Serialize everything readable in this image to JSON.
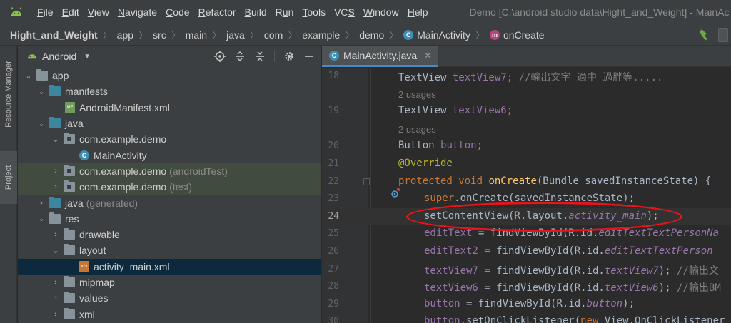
{
  "menu": {
    "items": [
      "File",
      "Edit",
      "View",
      "Navigate",
      "Code",
      "Refactor",
      "Build",
      "Run",
      "Tools",
      "VCS",
      "Window",
      "Help"
    ],
    "underlined": [
      "F",
      "E",
      "V",
      "N",
      "C",
      "R",
      "B",
      "u",
      "T",
      "S",
      "W",
      "H"
    ],
    "window_title": "Demo [C:\\android studio data\\Hight_and_Weight] - MainAc"
  },
  "breadcrumb": {
    "items": [
      "Hight_and_Weight",
      "app",
      "src",
      "main",
      "java",
      "com",
      "example",
      "demo"
    ],
    "class_item": "MainActivity",
    "method_item": "onCreate",
    "class_badge": "C",
    "method_badge": "m"
  },
  "sidebar_tabs": {
    "resource_manager": "Resource Manager",
    "project": "Project"
  },
  "project_panel": {
    "title": "Android",
    "tree": [
      {
        "label": "app",
        "suffix": ""
      },
      {
        "label": "manifests",
        "suffix": ""
      },
      {
        "label": "AndroidManifest.xml",
        "suffix": ""
      },
      {
        "label": "java",
        "suffix": ""
      },
      {
        "label": "com.example.demo",
        "suffix": ""
      },
      {
        "label": "MainActivity",
        "suffix": ""
      },
      {
        "label": "com.example.demo",
        "suffix": "(androidTest)"
      },
      {
        "label": "com.example.demo",
        "suffix": "(test)"
      },
      {
        "label": "java",
        "suffix": "(generated)"
      },
      {
        "label": "res",
        "suffix": ""
      },
      {
        "label": "drawable",
        "suffix": ""
      },
      {
        "label": "layout",
        "suffix": ""
      },
      {
        "label": "activity_main.xml",
        "suffix": ""
      },
      {
        "label": "mipmap",
        "suffix": ""
      },
      {
        "label": "values",
        "suffix": ""
      },
      {
        "label": "xml",
        "suffix": ""
      }
    ]
  },
  "editor": {
    "tab_label": "MainActivity.java",
    "tab_close": "✕",
    "usages_label": "2 usages",
    "line_numbers": [
      "18",
      "19",
      "20",
      "21",
      "22",
      "23",
      "24",
      "25",
      "26",
      "27",
      "28",
      "29",
      "30"
    ],
    "code": {
      "l18_type": "TextView ",
      "l18_field": "textView7",
      "l18_rest": "; ",
      "l18_comment": "//輸出文字 適中 過胖等.....",
      "l19_type": "TextView ",
      "l19_field": "textView6",
      "l19_rest": ";",
      "l20_type": "Button ",
      "l20_field": "button",
      "l20_rest": ";",
      "l21_ann": "@Override",
      "l22_kw": "protected void ",
      "l22_fn": "onCreate",
      "l22_rest": "(Bundle savedInstanceState) {",
      "l23_kw": "super",
      "l23_rest": ".onCreate(savedInstanceState);",
      "l24_a": "setContentView(R.layout.",
      "l24_b": "activity_main",
      "l24_c": ");",
      "l25_a": "editText",
      "l25_b": " = findViewById(R.id.",
      "l25_c": "editTextTextPersonNa",
      "l26_a": "editText2",
      "l26_b": " = findViewById(R.id.",
      "l26_c": "editTextTextPerson",
      "l27_a": "textView7",
      "l27_b": " = findViewById(R.id.",
      "l27_c": "textView7",
      "l27_d": "); ",
      "l27_e": "//輸出文",
      "l28_a": "textView6",
      "l28_b": " = findViewById(R.id.",
      "l28_c": "textView6",
      "l28_d": "); ",
      "l28_e": "//輸出BM",
      "l29_a": "button",
      "l29_b": " = findViewById(R.id.",
      "l29_c": "button",
      "l29_d": ");",
      "l30_a": "button",
      "l30_b": ".setOnClickListener(",
      "l30_c": "new ",
      "l30_d": "View.OnClickListener"
    }
  },
  "colors": {
    "background": "#2b2b2b",
    "panel": "#3c3f41",
    "highlight_row": "#424b3f",
    "selected_row": "#0d293e",
    "annotation_ellipse": "#e8141a",
    "keyword": "#cc7832",
    "field": "#9876aa",
    "function": "#ffc66d"
  }
}
